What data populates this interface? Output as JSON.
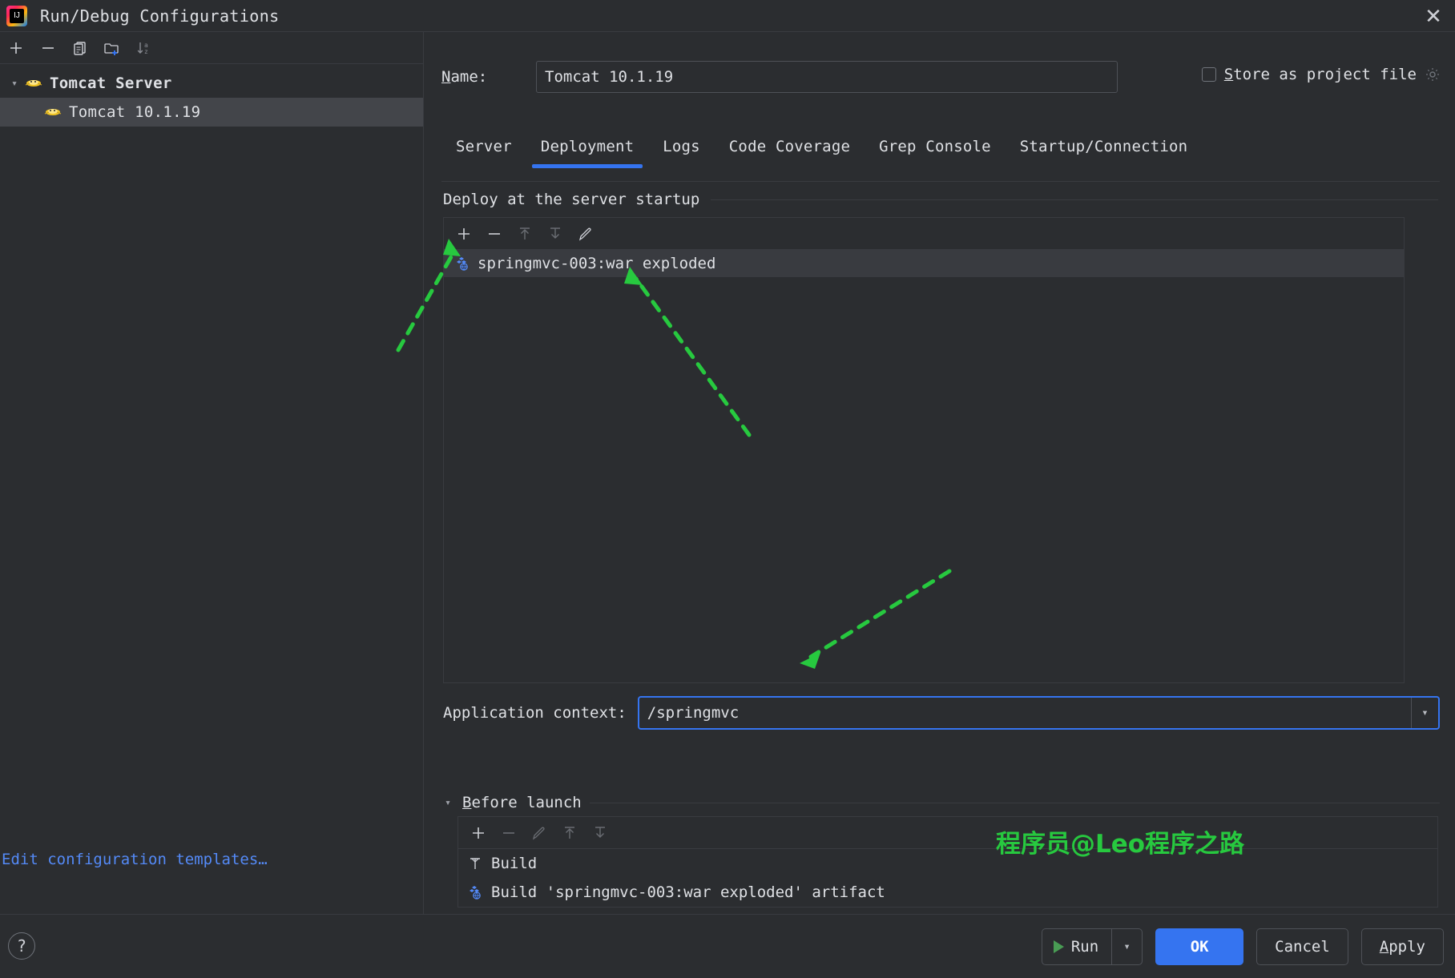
{
  "window": {
    "title": "Run/Debug Configurations",
    "logo_icon": "intellij-idea-logo-icon",
    "close_icon": "close-icon"
  },
  "left_panel": {
    "toolbar": [
      {
        "name": "add-configuration-button",
        "icon": "plus-icon",
        "label": "+"
      },
      {
        "name": "remove-configuration-button",
        "icon": "minus-icon",
        "label": "−"
      },
      {
        "name": "copy-configuration-button",
        "icon": "copy-icon",
        "label": "Copy"
      },
      {
        "name": "new-folder-button",
        "icon": "new-folder-icon",
        "label": "New Folder"
      },
      {
        "name": "sort-configurations-button",
        "icon": "sort-alphabetically-icon",
        "label": "Sort"
      }
    ],
    "tree": [
      {
        "label": "Tomcat Server",
        "icon": "tomcat-icon",
        "group": true,
        "expanded": true,
        "selected": false
      },
      {
        "label": "Tomcat 10.1.19",
        "icon": "tomcat-icon",
        "group": false,
        "expanded": false,
        "selected": true
      }
    ],
    "edit_templates_link": "Edit configuration templates…"
  },
  "form": {
    "name_label": "Name:",
    "name_label_mnemonic": "N",
    "name_label_rest": "ame:",
    "name_value": "Tomcat 10.1.19",
    "store_as_project_file_label": "Store as project file",
    "store_mnemonic": "S",
    "store_rest": "tore as project file",
    "store_checked": false,
    "store_gear_icon": "gear-icon"
  },
  "tabs": [
    {
      "label": "Server",
      "active": false
    },
    {
      "label": "Deployment",
      "active": true
    },
    {
      "label": "Logs",
      "active": false
    },
    {
      "label": "Code Coverage",
      "active": false
    },
    {
      "label": "Grep Console",
      "active": false
    },
    {
      "label": "Startup/Connection",
      "active": false
    }
  ],
  "deployment": {
    "section_title": "Deploy at the server startup",
    "toolbar": [
      {
        "name": "add-artifact-button",
        "icon": "plus-icon",
        "label": "+",
        "enabled": true
      },
      {
        "name": "remove-artifact-button",
        "icon": "minus-icon",
        "label": "−",
        "enabled": true
      },
      {
        "name": "move-artifact-up-button",
        "icon": "arrow-up-icon",
        "label": "Up",
        "enabled": false
      },
      {
        "name": "move-artifact-down-button",
        "icon": "arrow-down-icon",
        "label": "Down",
        "enabled": false
      },
      {
        "name": "edit-artifact-button",
        "icon": "pencil-icon",
        "label": "Edit",
        "enabled": true
      }
    ],
    "items": [
      {
        "label": "springmvc-003:war exploded",
        "icon": "artifact-icon",
        "selected": true
      }
    ],
    "application_context_label": "Application context:",
    "application_context_value": "/springmvc",
    "application_context_dropdown_icon": "chevron-down-icon"
  },
  "before_launch": {
    "title": "Before launch",
    "title_mnemonic": "B",
    "title_rest": "efore launch",
    "expanded": true,
    "collapse_icon": "chevron-down-icon",
    "toolbar": [
      {
        "name": "add-task-button",
        "icon": "plus-icon",
        "label": "+",
        "enabled": true
      },
      {
        "name": "remove-task-button",
        "icon": "minus-icon",
        "label": "−",
        "enabled": false
      },
      {
        "name": "edit-task-button",
        "icon": "pencil-icon",
        "label": "Edit",
        "enabled": false
      },
      {
        "name": "move-task-up-button",
        "icon": "arrow-up-icon",
        "label": "Up",
        "enabled": false
      },
      {
        "name": "move-task-down-button",
        "icon": "arrow-down-icon",
        "label": "Down",
        "enabled": false
      }
    ],
    "tasks": [
      {
        "label": "Build",
        "icon": "build-hammer-icon"
      },
      {
        "label": "Build 'springmvc-003:war exploded' artifact",
        "icon": "artifact-icon"
      }
    ]
  },
  "watermark": "程序员@Leo程序之路",
  "bottom_bar": {
    "help_label": "?",
    "help_icon": "question-mark-icon",
    "run_label": "Run",
    "run_icon": "play-triangle-icon",
    "run_dropdown_icon": "chevron-down-icon",
    "ok_label": "OK",
    "cancel_label": "Cancel",
    "apply_label": "Apply",
    "apply_mnemonic": "A",
    "apply_rest": "pply"
  },
  "colors": {
    "background": "#2b2d30",
    "accent_blue": "#3574f0",
    "link_blue": "#548af7",
    "selection": "#43454a",
    "border": "#393b40",
    "annotation_green": "#27c93f",
    "run_green": "#499c54"
  }
}
